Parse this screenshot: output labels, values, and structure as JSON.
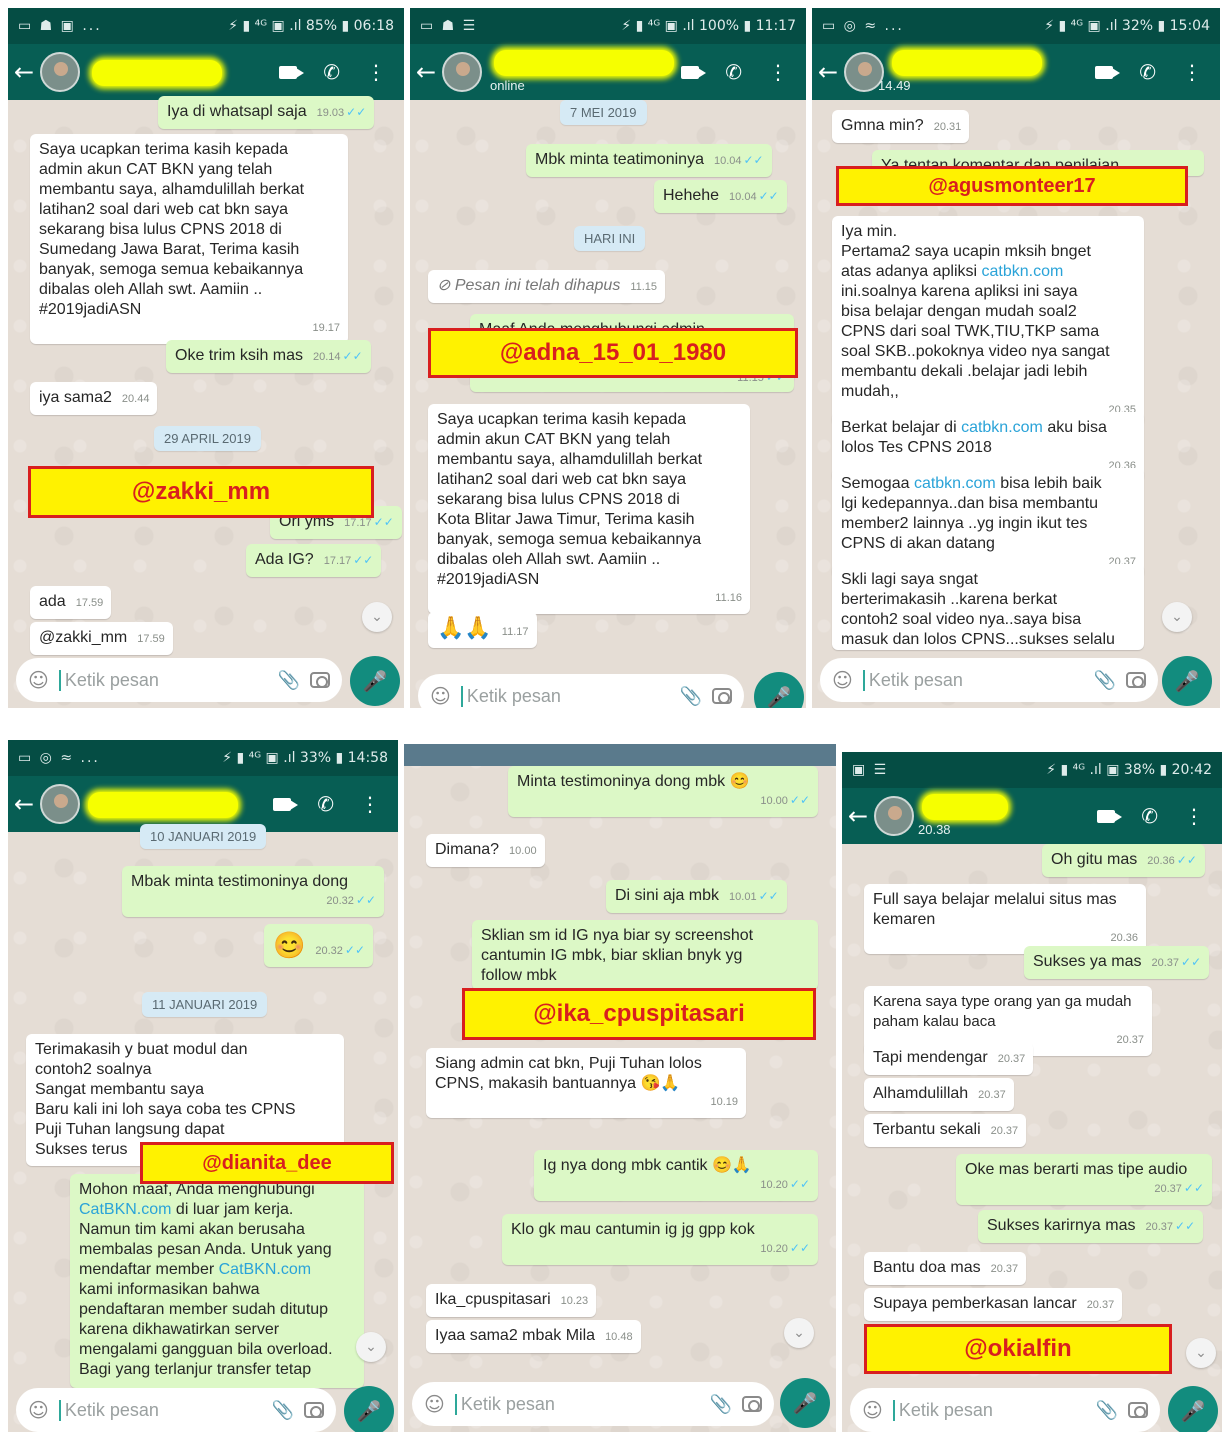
{
  "common": {
    "input_placeholder": "Ketik pesan",
    "back_icon": "←",
    "menu_icon": "⋮",
    "emoji_icon": "☺",
    "clip_icon": "📎",
    "mic_icon": "🎤",
    "call_icon": "✆",
    "down_icon": "⌄",
    "tick": "✓✓"
  },
  "panels": [
    {
      "status": {
        "left": "▭ ☗ ▣ ...",
        "right": "⚡ ▮ ⁴ᴳ ▣ .ıl 85% ▮ 06:18"
      },
      "header": {
        "subtitle": ""
      },
      "messages": [
        {
          "text": "Iya di whatsapl saja",
          "time": "19.03"
        },
        {
          "text": "Saya ucapkan terima kasih kepada\nadmin akun CAT BKN yang telah\nmembantu saya, alhamdulillah berkat\nlatihan2 soal dari web cat bkn saya\nsekarang bisa lulus CPNS 2018 di\nSumedang Jawa Barat, Terima kasih\nbanyak, semoga semua kebaikannya\ndibalas oleh Allah swt. Aamiin ..\n#2019jadiASN",
          "time": "19.17"
        },
        {
          "text": "Oke trim ksih mas",
          "time": "20.14"
        },
        {
          "text": "iya sama2",
          "time": "20.44"
        },
        {
          "text": "Ori yms",
          "time": "17.17"
        },
        {
          "text": "Ada IG?",
          "time": "17.17"
        },
        {
          "text": "ada",
          "time": "17.59"
        },
        {
          "text": "@zakki_mm",
          "time": "17.59"
        }
      ],
      "date_chip": "29 APRIL 2019",
      "handle": "@zakki_mm"
    },
    {
      "status": {
        "left": "▭ ☗ ☰",
        "right": "⚡ ▮ ⁴ᴳ ▣ .ıl 100% ▮ 11:17"
      },
      "header": {
        "subtitle": "online"
      },
      "date_chips": [
        "7 MEI 2019",
        "HARI INI"
      ],
      "messages": [
        {
          "text": "Mbk minta teatimoninya",
          "time": "10.04"
        },
        {
          "text": "Hehehe",
          "time": "10.04"
        },
        {
          "text": "Pesan ini telah dihapus",
          "time": "11.15",
          "icon": "⊘"
        },
        {
          "text": "Maaf Anda menghubungi admin",
          "time": "11.15"
        },
        {
          "text": "Saya ucapkan terima kasih kepada\nadmin akun CAT BKN yang telah\nmembantu saya, alhamdulillah berkat\nlatihan2 soal dari web cat bkn saya\nsekarang bisa lulus CPNS 2018 di\nKota Blitar Jawa Timur, Terima kasih\nbanyak, semoga semua kebaikannya\ndibalas oleh Allah swt. Aamiin ..\n#2019jadiASN",
          "time": "11.16"
        },
        {
          "text": "🙏🙏",
          "time": "11.17"
        }
      ],
      "handle": "@adna_15_01_1980"
    },
    {
      "status": {
        "left": "▭ ◎ ≈ ...",
        "right": "⚡ ▮ ⁴ᴳ ▣ .ıl 32% ▮ 15:04"
      },
      "header": {
        "subtitle": "14.49"
      },
      "messages": [
        {
          "text": "Gmna min?",
          "time": "20.31"
        },
        {
          "text": "Ya tentan komentar dan penilaian",
          "time": ""
        },
        {
          "pre": "Iya min.\nPertama2 saya ucapin mksih bnget\natas adanya apliksi ",
          "link": "catbkn.com",
          "post": "\nini.soalnya karena apliksi ini saya\nbisa belajar dengan mudah soal2\nCPNS dari soal TWK,TIU,TKP sama\nsoal SKB..pokoknya video nya sangat\nmembantu dekali .belajar jadi lebih\nmudah,,",
          "time": "20.35"
        },
        {
          "pre": "Berkat belajar di ",
          "link": "catbkn.com",
          "post": " aku bisa\nlolos Tes CPNS 2018",
          "time": "20.36"
        },
        {
          "pre": "Semogaa ",
          "link": "catbkn.com",
          "post": " bisa lebih baik\nlgi kedepannya..dan bisa membantu\nmember2 lainnya ..yg ingin ikut tes\nCPNS di akan datang",
          "time": "20.37"
        },
        {
          "text": "Skli lagi saya sngat\nberterimakasih ..karena berkat\ncontoh2 soal video nya..saya bisa\nmasuk dan lolos CPNS...sukses selalu",
          "time": ""
        }
      ],
      "handle": "@agusmonteer17"
    },
    {
      "status": {
        "left": "▭ ◎ ≈ ...",
        "right": "⚡ ▮ ⁴ᴳ ▣ .ıl 33% ▮ 14:58"
      },
      "header": {
        "subtitle": ""
      },
      "date_chips": [
        "10 JANUARI 2019",
        "11 JANUARI 2019"
      ],
      "messages": [
        {
          "text": "Mbak minta testimoninya dong",
          "time": "20.32"
        },
        {
          "text": "😊",
          "time": "20.32"
        },
        {
          "text": "Terimakasih y buat modul dan\ncontoh2 soalnya\nSangat membantu saya\nBaru kali ini loh saya coba tes CPNS\nPuji Tuhan langsung dapat\nSukses terus",
          "time": ""
        },
        {
          "pre": "Mohon maaf, Anda menghubungi\n",
          "link": "CatBKN.com",
          "mid": " di luar jam kerja.\nNamun tim kami akan berusaha\nmembalas pesan Anda. Untuk yang\nmendaftar member ",
          "link2": "CatBKN.com",
          "post": "\nkami informasikan bahwa\npendaftaran member sudah ditutup\nkarena dikhawatirkan server\nmengalami gangguan bila overload.\nBagi yang terlanjur transfer tetap",
          "time": ""
        }
      ],
      "handle": "@dianita_dee"
    },
    {
      "status": {
        "left": "",
        "right": ""
      },
      "header": {
        "subtitle": ""
      },
      "messages": [
        {
          "text": "Minta testimoninya dong mbk 😊",
          "time": "10.00"
        },
        {
          "text": "Dimana?",
          "time": "10.00"
        },
        {
          "text": "Di sini aja mbk",
          "time": "10.01"
        },
        {
          "text": "Sklian sm id IG nya biar sy screenshot\ncantumin IG mbk, biar sklian bnyk yg\nfollow mbk",
          "time": "10.01"
        },
        {
          "text": "Siang admin cat bkn, Puji Tuhan lolos\nCPNS, makasih bantuannya 😘🙏",
          "time": "10.19"
        },
        {
          "text": "Ig nya dong mbk cantik 😊🙏",
          "time": "10.20"
        },
        {
          "text": "Klo gk mau cantumin ig jg gpp kok",
          "time": "10.20"
        },
        {
          "text": "Ika_cpuspitasari",
          "time": "10.23"
        },
        {
          "text": "Iyaa sama2 mbak Mila",
          "time": "10.48"
        }
      ],
      "handle": "@ika_cpuspitasari"
    },
    {
      "status": {
        "left": "▣ ☰",
        "right": "⚡ ▮ ⁴ᴳ .ıl ▣ 38% ▮ 20:42"
      },
      "header": {
        "subtitle": "20.38"
      },
      "messages": [
        {
          "text": "Oh gitu mas",
          "time": "20.36"
        },
        {
          "text": "Full saya belajar melalui situs mas\nkemaren",
          "time": "20.36"
        },
        {
          "text": "Sukses ya mas",
          "time": "20.37"
        },
        {
          "text": "Karena saya type orang yan ga mudah\npaham kalau baca",
          "time": "20.37"
        },
        {
          "text": "Tapi mendengar",
          "time": "20.37"
        },
        {
          "text": "Alhamdulillah",
          "time": "20.37"
        },
        {
          "text": "Terbantu sekali",
          "time": "20.37"
        },
        {
          "text": "Oke mas berarti mas tipe audio",
          "time": "20.37"
        },
        {
          "text": "Sukses karirnya mas",
          "time": "20.37"
        },
        {
          "text": "Bantu doa mas",
          "time": "20.37"
        },
        {
          "text": "Supaya pemberkasan lancar",
          "time": "20.37"
        }
      ],
      "handle": "@okialfin"
    }
  ]
}
